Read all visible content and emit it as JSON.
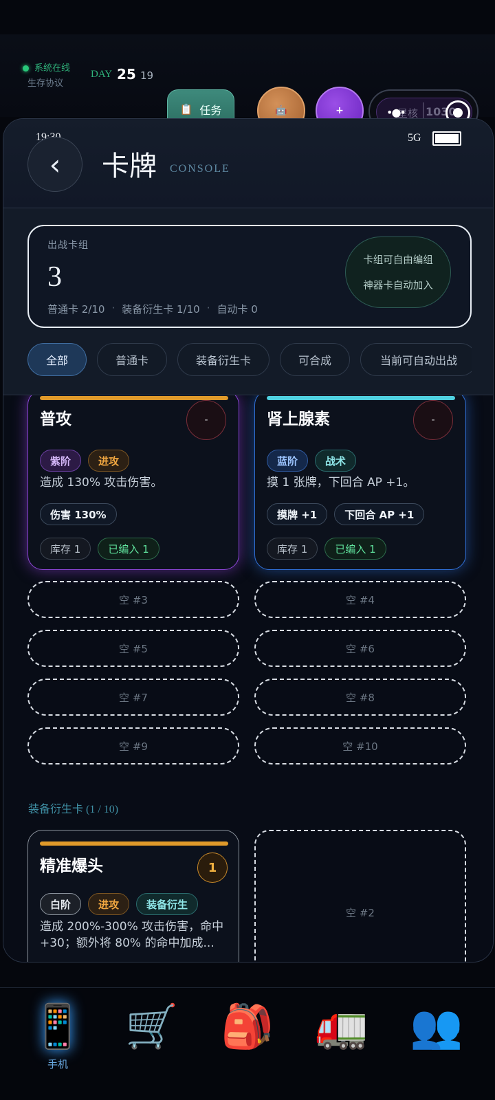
{
  "topbar": {
    "system_online": "系统在线",
    "survival_protocol": "生存协议",
    "day_label": "DAY",
    "day_num": "25",
    "day_sub": "19",
    "task_icon": "📋",
    "task_label": "任务",
    "bot_icon": "🤖",
    "plus_label": "+",
    "pill_label": "星核",
    "pill_value": "1030",
    "pill_dots": "•●•"
  },
  "phone": {
    "time": "19:30",
    "network": "5G",
    "back_icon": "‹",
    "title": "卡牌",
    "subtitle": "CONSOLE",
    "deck": {
      "label": "出战卡组",
      "count": "3",
      "normal": "普通卡 2/10",
      "equip": "装备衍生卡 1/10",
      "auto": "自动卡 0",
      "sep": "·",
      "note_line1": "卡组可自由编组",
      "note_line2": "神器卡自动加入"
    },
    "filters": [
      "全部",
      "普通卡",
      "装备衍生卡",
      "可合成",
      "当前可自动出战"
    ],
    "cards": [
      {
        "name": "普攻",
        "minus": "-",
        "tags": [
          "紫阶",
          "进攻"
        ],
        "desc": "造成 130% 攻击伤害。",
        "stats": [
          "伤害 130%"
        ],
        "stock": "库存 1",
        "deployed": "已编入 1"
      },
      {
        "name": "肾上腺素",
        "minus": "-",
        "tags": [
          "蓝阶",
          "战术"
        ],
        "desc": "摸 1 张牌，下回合 AP +1。",
        "stats": [
          "摸牌 +1",
          "下回合 AP +1"
        ],
        "stock": "库存 1",
        "deployed": "已编入 1"
      }
    ],
    "empty_slots": [
      "空 #3",
      "空 #4",
      "空 #5",
      "空 #6",
      "空 #7",
      "空 #8",
      "空 #9",
      "空 #10"
    ],
    "equip_section": {
      "title": "装备衍生卡 (1 / 10)",
      "card": {
        "name": "精准爆头",
        "badge": "1",
        "tags": [
          "白阶",
          "进攻",
          "装备衍生"
        ],
        "desc": "造成 200%-300% 攻击伤害，命中+30；额外将 80% 的命中加成..."
      },
      "empty": "空 #2"
    }
  },
  "nav": {
    "items": [
      {
        "icon": "📱",
        "label": "手机"
      },
      {
        "icon": "🛒",
        "label": ""
      },
      {
        "icon": "🎒",
        "label": ""
      },
      {
        "icon": "🚛",
        "label": ""
      },
      {
        "icon": "👥",
        "label": ""
      }
    ]
  },
  "colors": {
    "accent_green": "#2fb27a",
    "purple_glow": "#8a3fd0",
    "blue_glow": "#2f6fd6",
    "orange_bar": "#e09a2a",
    "cyan_bar": "#4fd0e0"
  }
}
